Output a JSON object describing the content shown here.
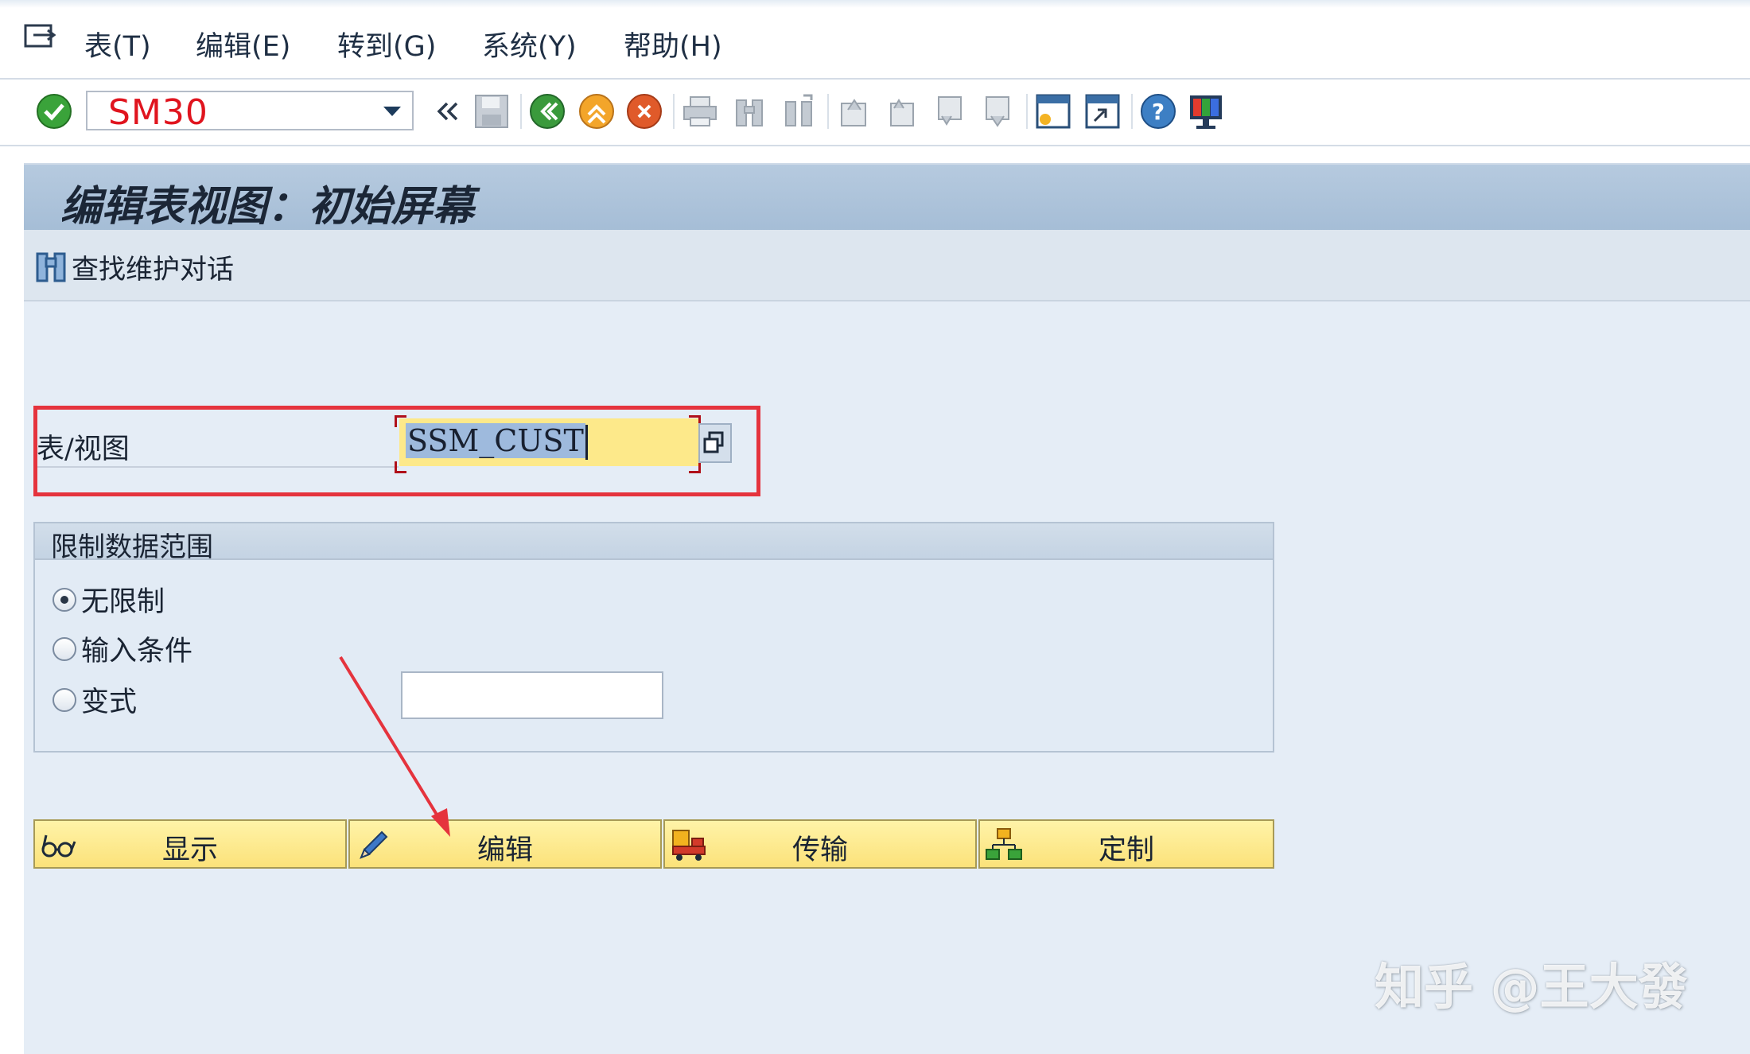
{
  "menubar": {
    "items": [
      {
        "label": "表(T)"
      },
      {
        "label": "编辑(E)"
      },
      {
        "label": "转到(G)"
      },
      {
        "label": "系统(Y)"
      },
      {
        "label": "帮助(H)"
      }
    ]
  },
  "toolbar": {
    "command_value": "SM30",
    "icons": [
      "enter-check-icon",
      "back-icon",
      "exit-icon",
      "cancel-icon",
      "print-icon",
      "find-icon",
      "find-next-icon",
      "first-page-icon",
      "previous-page-icon",
      "next-page-icon",
      "last-page-icon",
      "create-session-icon",
      "shortcut-icon",
      "help-icon",
      "layout-icon"
    ]
  },
  "screen": {
    "title": "编辑表视图：初始屏幕",
    "find_dialog_label": "查找维护对话"
  },
  "table_view": {
    "label": "表/视图",
    "value": "SSM_CUST"
  },
  "restrict": {
    "title": "限制数据范围",
    "options": [
      {
        "label": "无限制",
        "checked": true
      },
      {
        "label": "输入条件",
        "checked": false
      },
      {
        "label": "变式",
        "checked": false
      }
    ],
    "variant_value": ""
  },
  "actions": [
    {
      "label": "显示",
      "icon": "glasses-icon"
    },
    {
      "label": "编辑",
      "icon": "pencil-icon"
    },
    {
      "label": "传输",
      "icon": "truck-icon"
    },
    {
      "label": "定制",
      "icon": "hierarchy-icon"
    }
  ],
  "watermark": "知乎 @王大發",
  "colors": {
    "command_text": "#e0141e",
    "highlight": "#e5333d",
    "input_yellow": "#fde98a",
    "title_bar": "#a5bdd6"
  }
}
